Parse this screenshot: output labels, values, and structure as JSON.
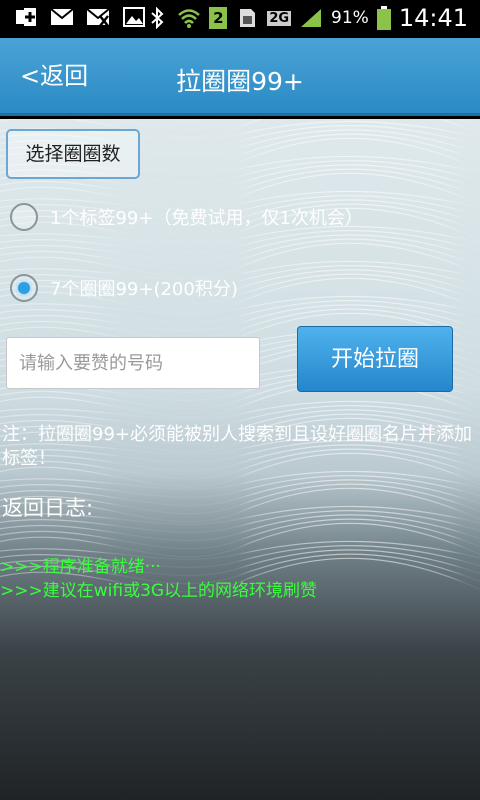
{
  "status_bar": {
    "icons": [
      "add-icon",
      "mail-icon",
      "mail-off-icon",
      "image-icon",
      "bluetooth-icon",
      "wifi-icon",
      "sim-icon",
      "signal-icon",
      "battery-icon"
    ],
    "sim_number": "2",
    "network": "2G",
    "battery": "91%",
    "time": "14:41"
  },
  "header": {
    "back_label": "<返回",
    "title": "拉圈圈99+"
  },
  "content": {
    "select_button": "选择圈圈数",
    "options": [
      {
        "label": "1个标签99+（免费试用，仅1次机会）",
        "selected": false
      },
      {
        "label": "7个圈圈99+(200积分)",
        "selected": true
      }
    ],
    "input_placeholder": "请输入要赞的号码",
    "input_value": "",
    "start_button": "开始拉圈",
    "note": "注：拉圈圈99+必须能被别人搜索到且设好圈圈名片并添加标签！",
    "log_title": "返回日志:",
    "log_lines": [
      ">>>程序准备就绪···",
      ">>>建议在wifi或3G以上的网络环境刷赞"
    ]
  },
  "colors": {
    "header_bg": "#2b8ac4",
    "button_bg": "#2e9fe2",
    "log_text": "#38ff3a"
  }
}
